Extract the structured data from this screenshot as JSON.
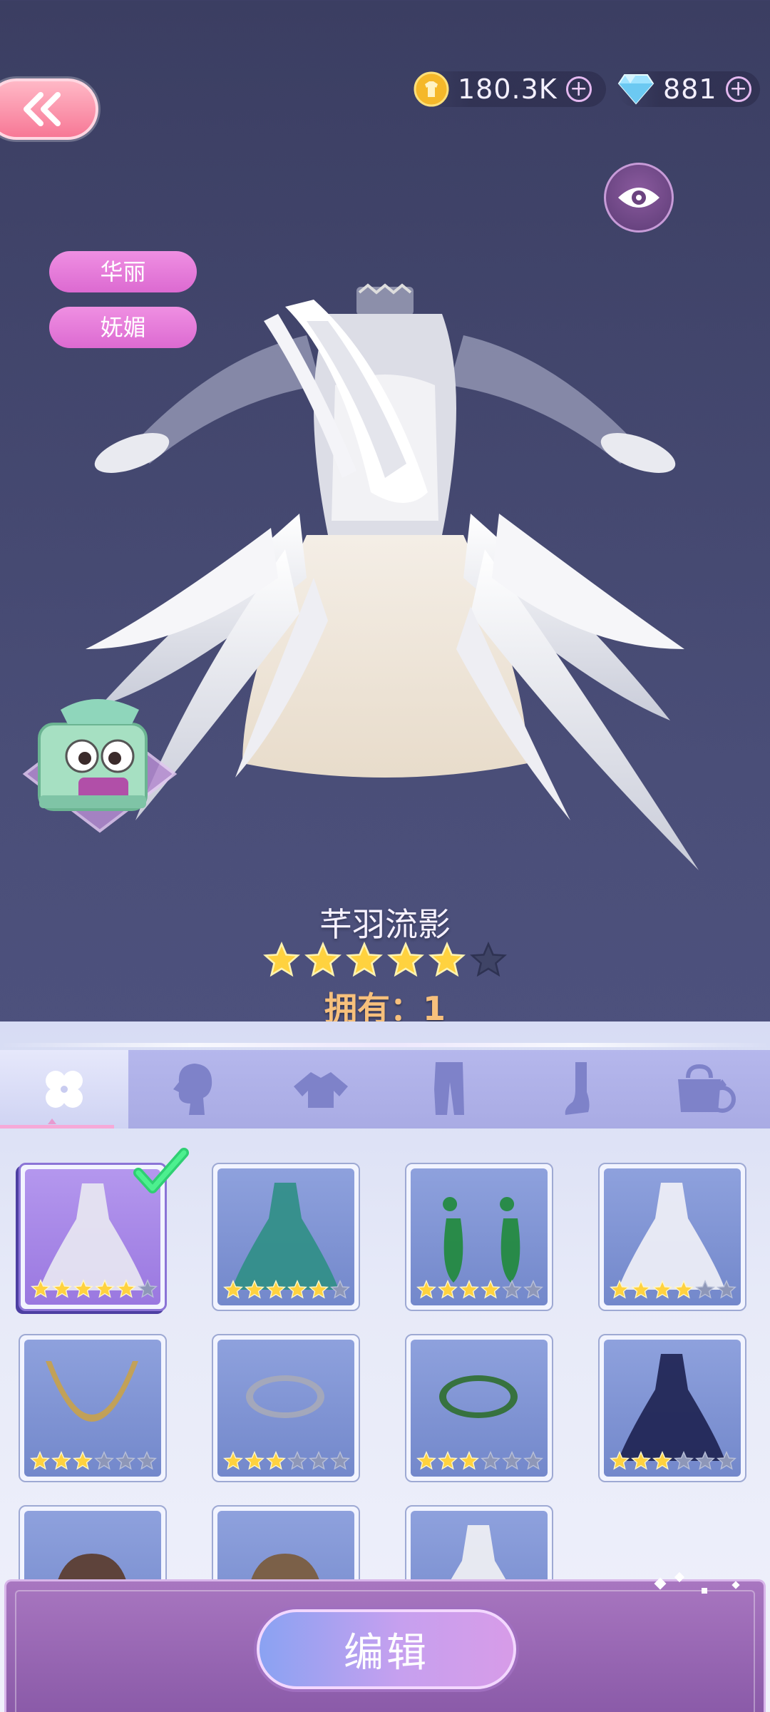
{
  "top_bar": {
    "gold": {
      "value": "180.3K",
      "icon": "gold-coin-icon"
    },
    "diamond": {
      "value": "881",
      "icon": "diamond-icon"
    }
  },
  "tags": [
    "华丽",
    "妩媚"
  ],
  "item": {
    "name": "芊羽流影",
    "rating": 5,
    "max_rating": 6,
    "owned_label": "拥有：1"
  },
  "tabs": [
    {
      "name": "all-items",
      "icon": "clover-icon",
      "active": true
    },
    {
      "name": "hair",
      "icon": "hair-silhouette-icon",
      "active": false
    },
    {
      "name": "tops",
      "icon": "top-garment-icon",
      "active": false
    },
    {
      "name": "bottoms",
      "icon": "pants-icon",
      "active": false
    },
    {
      "name": "shoes",
      "icon": "foot-icon",
      "active": false
    },
    {
      "name": "accessories",
      "icon": "bag-ring-icon",
      "active": false
    }
  ],
  "grid_items": [
    {
      "name": "white-feather-dress",
      "stars": 5,
      "selected": true
    },
    {
      "name": "teal-robe-dress",
      "stars": 5,
      "selected": false
    },
    {
      "name": "emerald-earrings",
      "stars": 4,
      "selected": false
    },
    {
      "name": "white-lace-gown",
      "stars": 4,
      "selected": false
    },
    {
      "name": "gold-necklace",
      "stars": 3,
      "selected": false
    },
    {
      "name": "silver-bracelets",
      "stars": 3,
      "selected": false
    },
    {
      "name": "pearl-jade-bracelet",
      "stars": 3,
      "selected": false
    },
    {
      "name": "navy-bow-dress",
      "stars": 3,
      "selected": false
    },
    {
      "name": "hair-ornament",
      "stars": 0,
      "selected": false
    },
    {
      "name": "hat-item",
      "stars": 0,
      "selected": false
    },
    {
      "name": "strapless-dress",
      "stars": 0,
      "selected": false
    }
  ],
  "card_max_stars": 6,
  "edit_button_label": "编辑",
  "colors": {
    "star_gold": "#ffd23f",
    "star_empty": "#8e97b8",
    "accent_pink": "#dc6ad1",
    "panel_bg": "#e7eaf8"
  }
}
